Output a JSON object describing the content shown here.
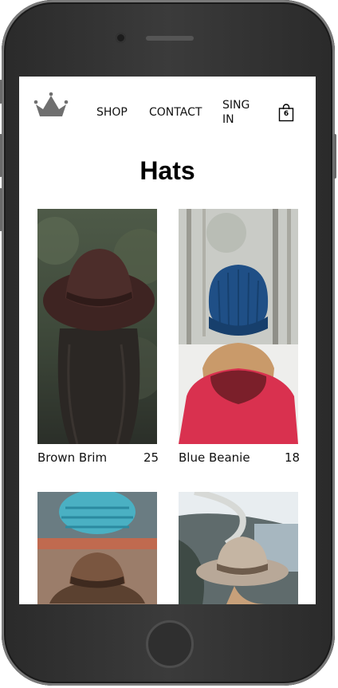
{
  "nav": {
    "logo_icon": "crown-icon",
    "links": [
      {
        "label": "SHOP"
      },
      {
        "label": "CONTACT"
      },
      {
        "label": "SING"
      },
      {
        "label": "IN"
      }
    ],
    "cart": {
      "icon": "shopping-bag-icon",
      "count": "6"
    }
  },
  "page": {
    "title": "Hats"
  },
  "products": [
    {
      "name": "Brown Brim",
      "price": "25",
      "image": "brown-brim-hat-photo"
    },
    {
      "name": "Blue Beanie",
      "price": "18",
      "image": "blue-beanie-photo"
    },
    {
      "name": "",
      "price": "",
      "image": "brown-cowboy-hat-photo"
    },
    {
      "name": "",
      "price": "",
      "image": "tan-fedora-photo"
    }
  ],
  "colors": {
    "text": "#111111",
    "background": "#ffffff",
    "device": "#2f2f2f"
  }
}
